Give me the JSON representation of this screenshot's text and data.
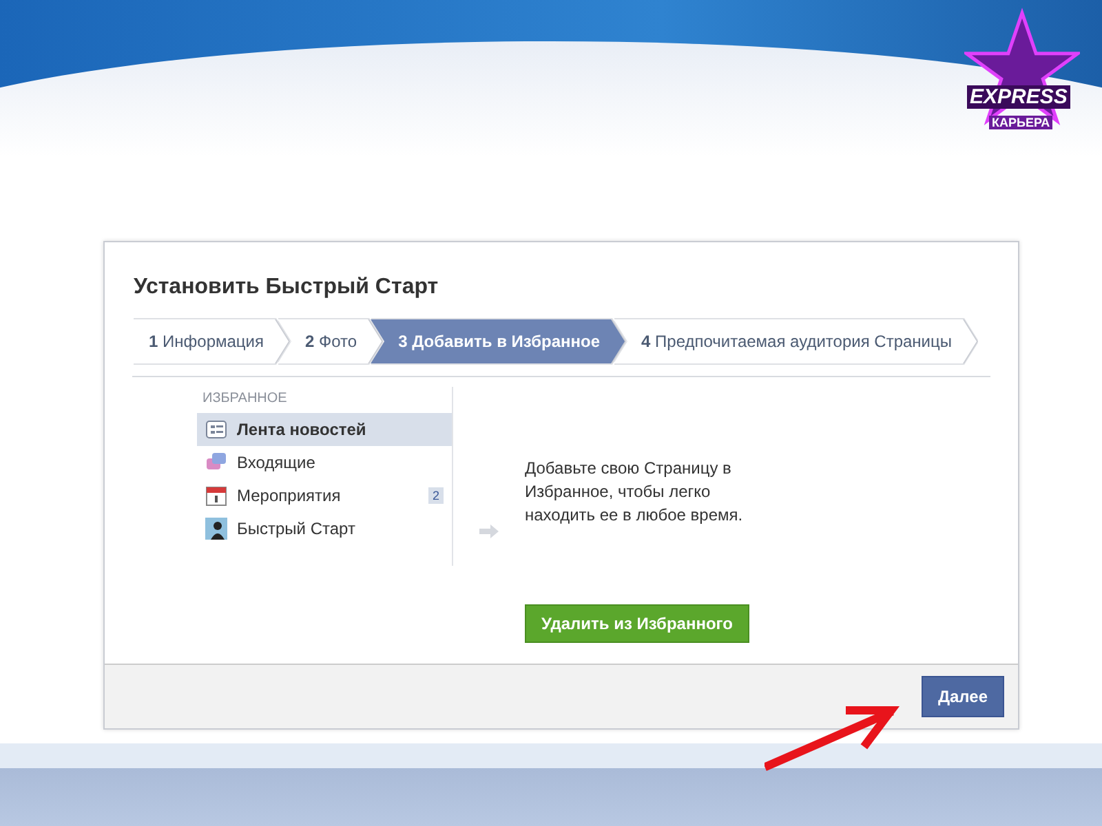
{
  "logo": {
    "word": "EXPRESS",
    "subtitle": "КАРЬЕРА"
  },
  "dialog": {
    "title": "Установить Быстрый Старт",
    "steps": [
      {
        "number": "1",
        "label": "Информация",
        "selected": false
      },
      {
        "number": "2",
        "label": "Фото",
        "selected": false
      },
      {
        "number": "3",
        "label": "Добавить в Избранное",
        "selected": true
      },
      {
        "number": "4",
        "label": "Предпочитаемая аудитория Страницы",
        "selected": false
      }
    ],
    "favorites": {
      "heading": "ИЗБРАННОЕ",
      "items": [
        {
          "kind": "news",
          "label": "Лента новостей",
          "selected": true
        },
        {
          "kind": "messages",
          "label": "Входящие",
          "selected": false
        },
        {
          "kind": "events",
          "label": "Мероприятия",
          "selected": false,
          "count": "2"
        },
        {
          "kind": "page",
          "label": "Быстрый Старт",
          "selected": false
        }
      ]
    },
    "description": "Добавьте свою Страницу в Избранное, чтобы легко находить ее в любое время.",
    "remove_button": "Удалить из Избранного",
    "next_button": "Далее"
  }
}
